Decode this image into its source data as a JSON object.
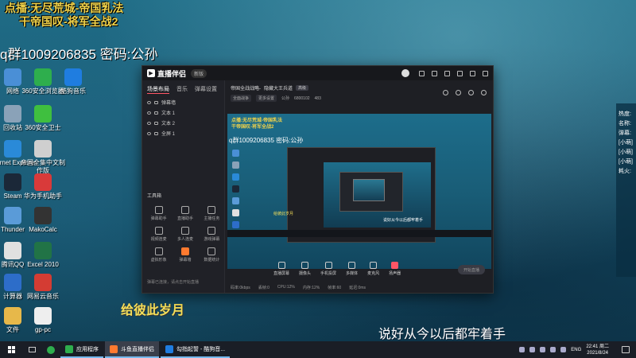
{
  "overlay": {
    "line1": "点播:无尽荒城-帝国乳法",
    "line2": "干帝国叹-将军全战2",
    "qq": "q群1009206835 密码:公孙"
  },
  "desktop_icons": [
    {
      "label": "网络",
      "icon": "network-icon",
      "color": "#4a8fd6"
    },
    {
      "label": "360安全浏览器",
      "icon": "360-browser-icon",
      "color": "#2eae4d"
    },
    {
      "label": "酷狗音乐",
      "icon": "kugou-icon",
      "color": "#1f7de0"
    },
    {
      "label": "回收站",
      "icon": "recycle-bin-icon",
      "color": "#8aa2b8"
    },
    {
      "label": "360安全卫士",
      "icon": "360-guard-icon",
      "color": "#3fbf3f"
    },
    {
      "label": "Internet Explorer",
      "icon": "ie-icon",
      "color": "#2a8ad8"
    },
    {
      "label": "帝国全集中文制作版",
      "icon": "empire-icon",
      "color": "#cfcfcf"
    },
    {
      "label": "Steam",
      "icon": "steam-icon",
      "color": "#1b2838"
    },
    {
      "label": "华为手机助手",
      "icon": "huawei-icon",
      "color": "#d93a3a"
    },
    {
      "label": "Thunder",
      "icon": "thunder-icon",
      "color": "#5a9bd8"
    },
    {
      "label": "MakoCalc",
      "icon": "calc-icon",
      "color": "#333333"
    },
    {
      "label": "腾讯QQ",
      "icon": "qq-icon",
      "color": "#e0e0e0"
    },
    {
      "label": "Excel 2010",
      "icon": "excel-icon",
      "color": "#217346"
    },
    {
      "label": "计算器",
      "icon": "calculator-icon",
      "color": "#2d6dc9"
    },
    {
      "label": "网易云音乐",
      "icon": "netease-music-icon",
      "color": "#d43c33"
    },
    {
      "label": "文件",
      "icon": "folder-icon",
      "color": "#e7b84a"
    },
    {
      "label": "gp-pc",
      "icon": "gp-pc-icon",
      "color": "#eeeeee"
    }
  ],
  "lyrics": {
    "line1": "给彼此岁月",
    "line2": "说好从今以后都牢着手"
  },
  "chat": [
    "热度:",
    "名称:",
    "弹幕:",
    "[小萌]",
    "[小萌]",
    "[小萌]",
    "耗火:"
  ],
  "app": {
    "name": "直播伴侣",
    "version": "新版",
    "left_tabs": [
      "场景布局",
      "音乐",
      "弹幕设置"
    ],
    "scenes": [
      "弹幕墙",
      "文本 1",
      "文本 2",
      "全屏 1"
    ],
    "tools_head": "工具箱",
    "tools": [
      {
        "label": "弹幕助手",
        "hl": false
      },
      {
        "label": "直播助手",
        "hl": false
      },
      {
        "label": "主播任务",
        "hl": false
      },
      {
        "label": "视频连麦",
        "hl": false
      },
      {
        "label": "多人连麦",
        "hl": false
      },
      {
        "label": "游戏弹幕",
        "hl": false
      },
      {
        "label": "虚拟形象",
        "hl": false
      },
      {
        "label": "弹幕墙",
        "hl": true
      },
      {
        "label": "数据统计",
        "hl": false
      }
    ],
    "left_footer": "弹幕已连接，请点击开始直播",
    "room_title": "帝国全战战略-",
    "room_subtitle": "隐藏大王兵道",
    "room_tag": "高级",
    "room_sub": [
      "全面战争",
      "更多设置",
      "公孙",
      "6800102",
      "483"
    ],
    "preview_overlay1": "点播:无尽荒城-帝国乳法",
    "preview_overlay2": "干帝国叹-将军全战2",
    "preview_qq": "q群1009206835 密码:公孙",
    "preview_lyric1": "给彼此岁月",
    "preview_lyric2": "说好从今以后都牢着手",
    "toolbar": [
      "直播屏幕",
      "摄像头",
      "手机投屏",
      "多媒体",
      "麦克风",
      "扬声器"
    ],
    "start_label": "开始直播",
    "status": [
      "码率:0kbps",
      "丢帧:0",
      "CPU:12%",
      "内存:12%",
      "帧率:60",
      "延迟:0ms"
    ]
  },
  "taskbar": {
    "apps": [
      {
        "label": "应用程序",
        "color": "#2eae4d",
        "active": false
      },
      {
        "label": "斗鱼直播伴侣",
        "color": "#ff7a2f",
        "active": true
      },
      {
        "label": "勾指起誓 - 酷狗音...",
        "color": "#1f7de0",
        "active": false
      }
    ],
    "ime": "ENG",
    "time": "22:41 周二",
    "date": "2021/8/24"
  }
}
